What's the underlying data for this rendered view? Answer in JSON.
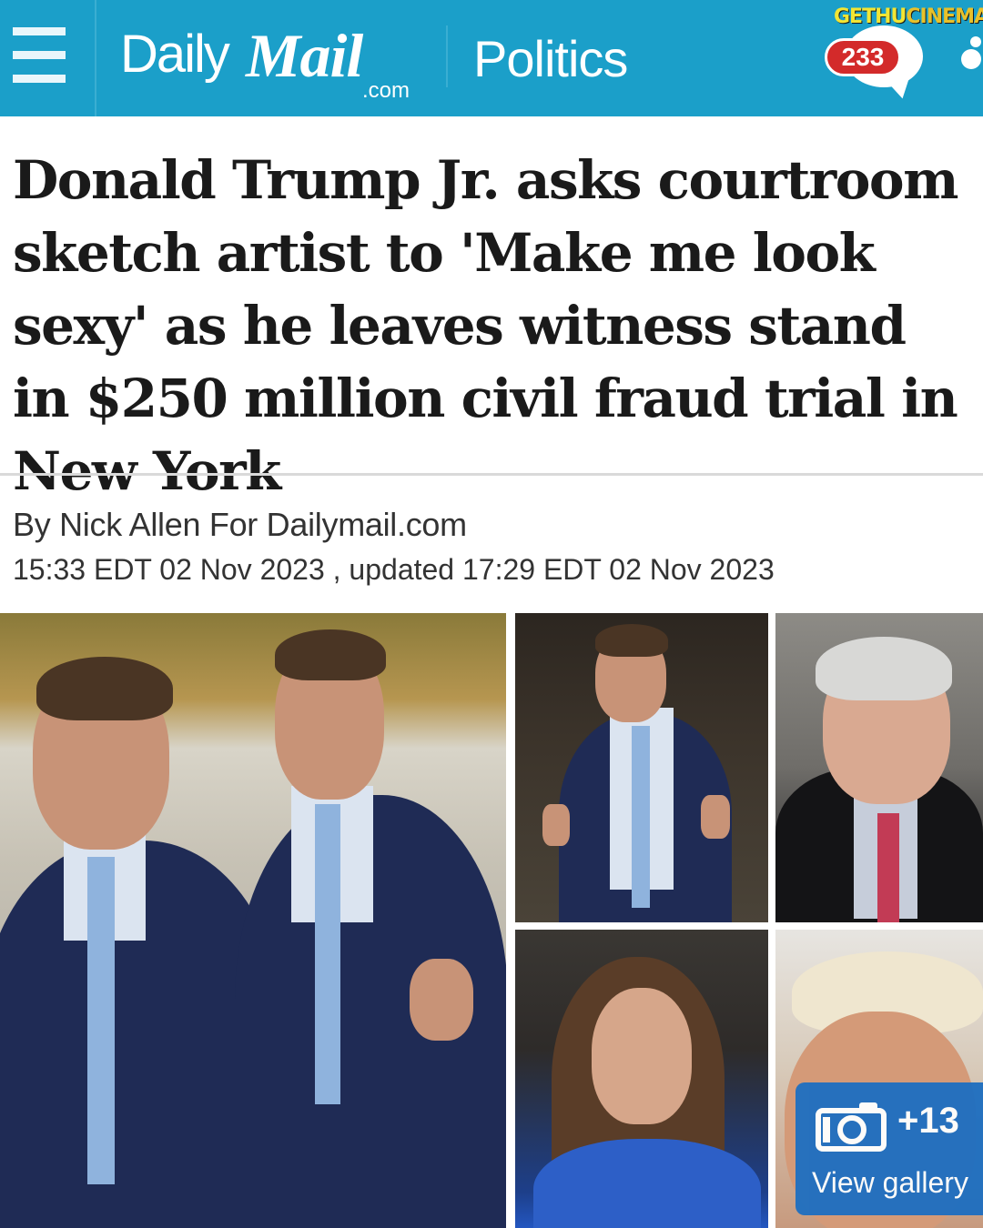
{
  "header": {
    "menu_icon": "hamburger-menu-icon",
    "logo_daily": "Daily",
    "logo_mail": "Mail",
    "logo_com": ".com",
    "section": "Politics",
    "comment_count": "233",
    "comment_icon": "speech-bubble-icon",
    "share_icon": "share-icon",
    "brand_color": "#1b9fc9",
    "badge_color": "#d32a2a"
  },
  "watermark": {
    "part1": "GETHU",
    "part2": "CINEMA"
  },
  "article": {
    "headline": "Donald Trump Jr. asks courtroom sketch artist to 'Make me look sexy' as he leaves witness stand in $250 million civil fraud trial in New York",
    "byline": "By Nick Allen For Dailymail.com",
    "dateline": "15:33 EDT 02 Nov 2023 , updated 17:29 EDT 02 Nov 2023"
  },
  "gallery": {
    "extra_count": "+13",
    "label": "View gallery",
    "icon": "camera-icon",
    "badge_color": "#1f6fc0"
  }
}
